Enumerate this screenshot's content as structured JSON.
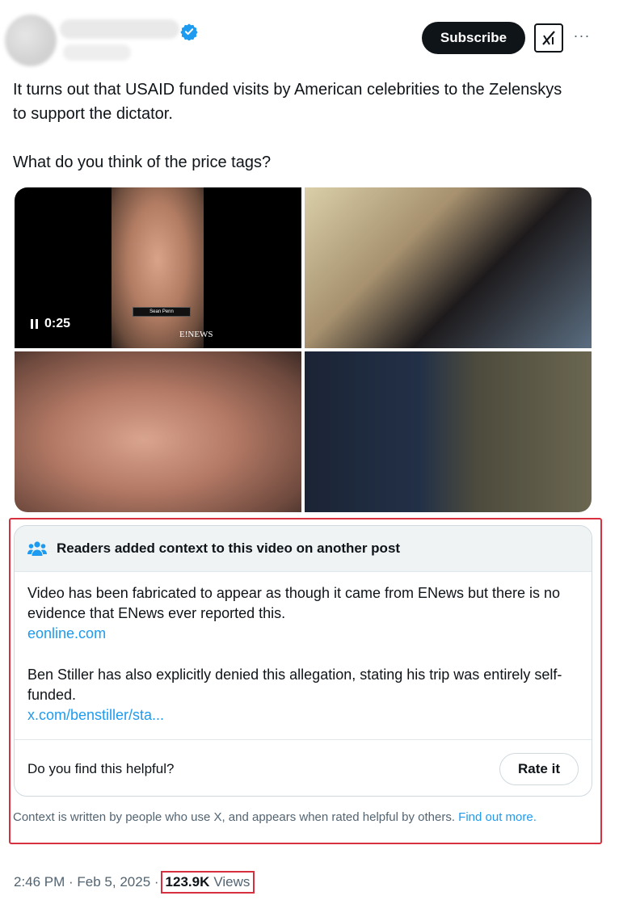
{
  "post": {
    "subscribe_label": "Subscribe",
    "more_label": "···",
    "text_line1": "It turns out that USAID funded visits by American celebrities to the Zelenskys to support the dictator.",
    "text_line2": "What do you think of the price tags?"
  },
  "media": {
    "video_duration": "0:25",
    "inner_caption": "Sean Penn",
    "inner_brand": "E!NEWS"
  },
  "note": {
    "title": "Readers added context to this video on another post",
    "para1": "Video has been fabricated to appear as though it came from ENews but there is no evidence that ENews ever reported this.",
    "link1": "eonline.com",
    "para2": "Ben Stiller has also explicitly denied this allegation, stating his trip was entirely self-funded.",
    "link2": "x.com/benstiller/sta...",
    "helpful_question": "Do you find this helpful?",
    "rate_label": "Rate it",
    "disclaimer": "Context is written by people who use X, and appears when rated helpful by others.",
    "find_out_more": "Find out more."
  },
  "meta": {
    "timestamp": "2:46 PM · Feb 5, 2025 ·",
    "views_count": "123.9K",
    "views_label": "Views"
  },
  "colors": {
    "accent_blue": "#1d9bf0",
    "highlight_red": "#d7313f",
    "button_dark": "#0f1419"
  }
}
